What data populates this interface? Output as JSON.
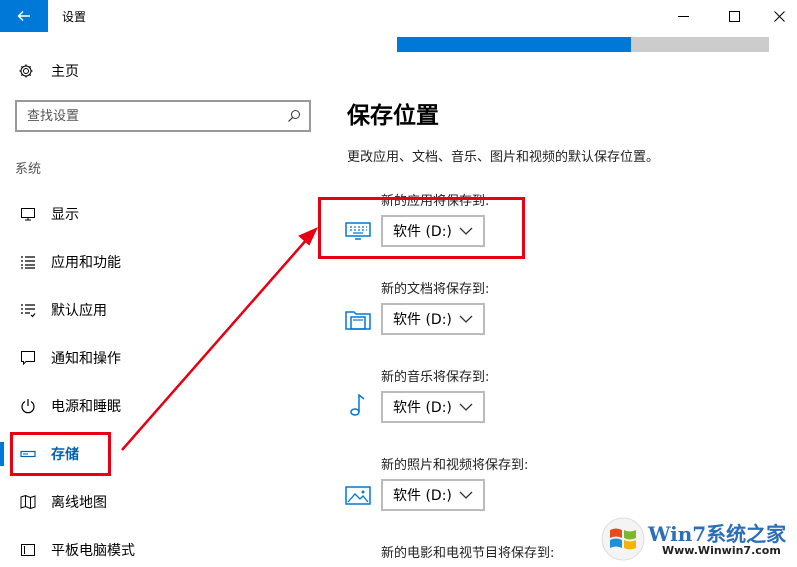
{
  "window": {
    "title": "设置",
    "back_icon": "arrow-left-icon",
    "controls": [
      "minimize-icon",
      "maximize-icon",
      "close-icon"
    ],
    "accent": "#0078d7"
  },
  "sidebar": {
    "home": {
      "label": "主页",
      "icon": "gear-icon"
    },
    "search": {
      "placeholder": "查找设置",
      "icon": "search-icon"
    },
    "section": "系统",
    "items": [
      {
        "label": "显示",
        "icon": "monitor-icon",
        "active": false
      },
      {
        "label": "应用和功能",
        "icon": "list-icon",
        "active": false
      },
      {
        "label": "默认应用",
        "icon": "list-check-icon",
        "active": false
      },
      {
        "label": "通知和操作",
        "icon": "notification-icon",
        "active": false
      },
      {
        "label": "电源和睡眠",
        "icon": "power-icon",
        "active": false
      },
      {
        "label": "存储",
        "icon": "storage-drive-icon",
        "active": true
      },
      {
        "label": "离线地图",
        "icon": "map-icon",
        "active": false
      },
      {
        "label": "平板电脑模式",
        "icon": "tablet-icon",
        "active": false
      }
    ]
  },
  "storage_bar": {
    "used_fraction": 0.63,
    "fill_color": "#0078d7",
    "track_color": "#cccccc"
  },
  "save_locations": {
    "title": "保存位置",
    "description": "更改应用、文档、音乐、图片和视频的默认保存位置。",
    "items": [
      {
        "label": "新的应用将保存到:",
        "value": "软件 (D:)",
        "icon": "app-keyboard-icon"
      },
      {
        "label": "新的文档将保存到:",
        "value": "软件 (D:)",
        "icon": "folder-document-icon"
      },
      {
        "label": "新的音乐将保存到:",
        "value": "软件 (D:)",
        "icon": "music-note-icon"
      },
      {
        "label": "新的照片和视频将保存到:",
        "value": "软件 (D:)",
        "icon": "picture-icon"
      },
      {
        "label": "新的电影和电视节目将保存到:",
        "value": "",
        "icon": ""
      }
    ]
  },
  "annotation": {
    "color": "#e60012"
  },
  "watermark": {
    "text": "Win7系统之家",
    "url": "Www.Winwin7.com"
  }
}
